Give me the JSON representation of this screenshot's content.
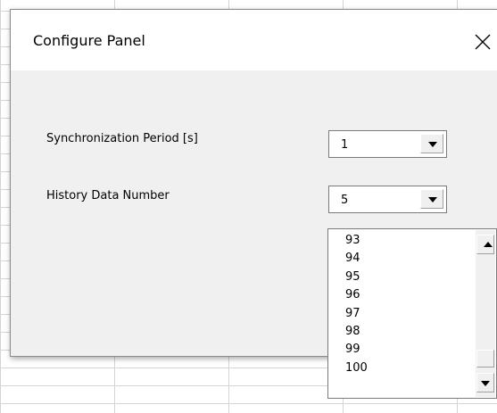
{
  "dialog": {
    "title": "Configure Panel",
    "close_icon": "close-icon"
  },
  "fields": {
    "sync_period": {
      "label": "Synchronization Period [s]",
      "value": "1"
    },
    "history_number": {
      "label": "History Data Number",
      "value": "5"
    }
  },
  "dropdown": {
    "items": [
      "93",
      "94",
      "95",
      "96",
      "97",
      "98",
      "99",
      "100"
    ],
    "scroll_up_icon": "scroll-up-arrow-icon",
    "scroll_down_icon": "scroll-down-arrow-icon"
  },
  "colors": {
    "dialog_bg": "#f0f0f0",
    "titlebar_bg": "#ffffff",
    "grid_line": "#d4d4d4"
  }
}
